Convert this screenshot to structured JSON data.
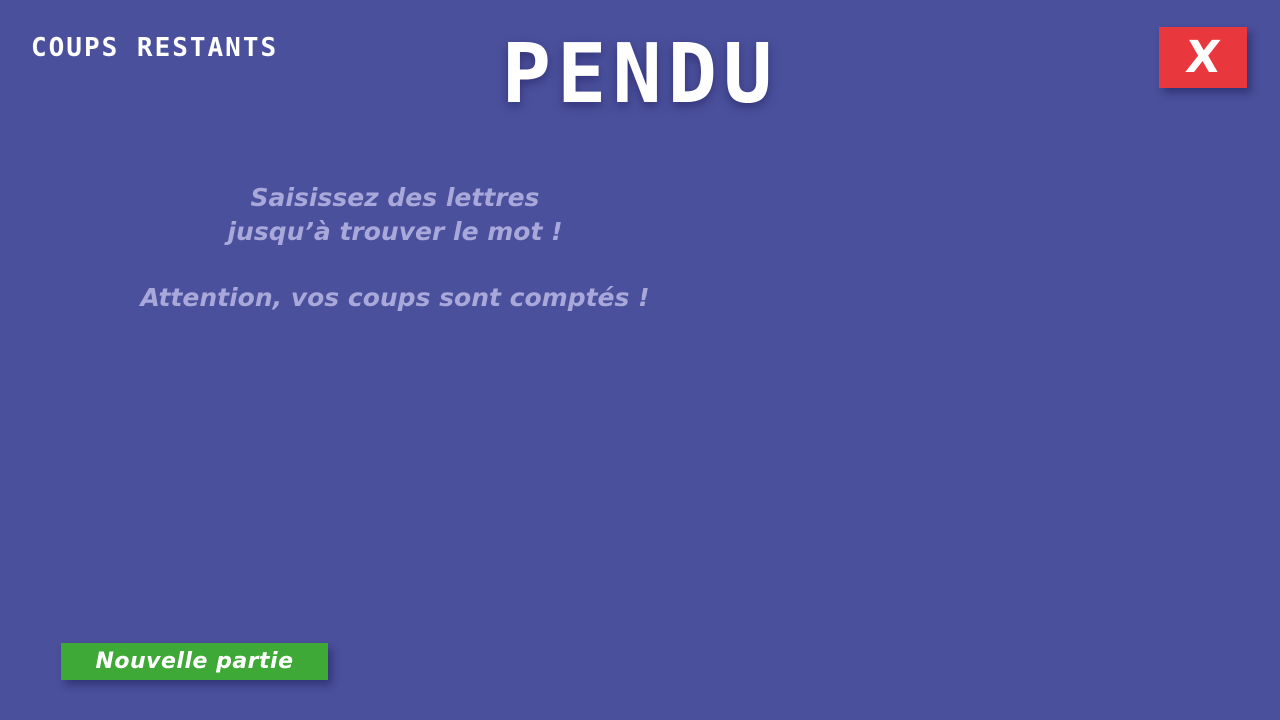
{
  "game": {
    "title": "PENDU",
    "remaining_label": "COUPS RESTANTS"
  },
  "close_button": {
    "label": "X",
    "color": "#e8383d"
  },
  "instructions": {
    "line1": "Saisissez des lettres",
    "line2": "jusqu’à trouver le mot !",
    "line3": "Attention, vos coups sont comptés !"
  },
  "new_game_button": {
    "label": "Nouvelle partie",
    "color": "#3ea936"
  },
  "colors": {
    "background": "#4b509c",
    "instruction_text": "#a8a8da",
    "text": "#ffffff"
  }
}
